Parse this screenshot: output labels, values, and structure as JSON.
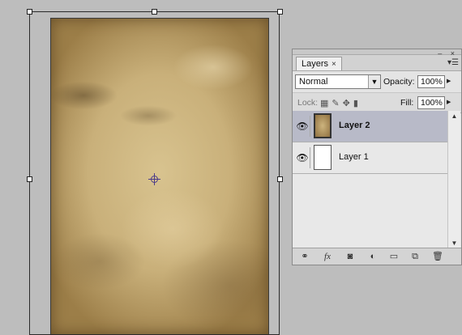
{
  "panel": {
    "tab_label": "Layers",
    "tab_close": "×",
    "blend_mode": "Normal",
    "opacity_label": "Opacity:",
    "opacity_value": "100%",
    "lock_label": "Lock:",
    "fill_label": "Fill:",
    "fill_value": "100%"
  },
  "layers": [
    {
      "name": "Layer 2",
      "selected": true,
      "visible": true,
      "thumb": "paper-texture"
    },
    {
      "name": "Layer 1",
      "selected": false,
      "visible": true,
      "thumb": "white"
    }
  ],
  "icons": {
    "eye": "eye-icon",
    "link": "link-layers-icon",
    "fx": "layer-style-icon",
    "mask": "add-mask-icon",
    "adjust": "adjustment-layer-icon",
    "group": "new-group-icon",
    "new": "new-layer-icon",
    "trash": "delete-layer-icon"
  },
  "footer": {
    "fx_label": "fx"
  }
}
